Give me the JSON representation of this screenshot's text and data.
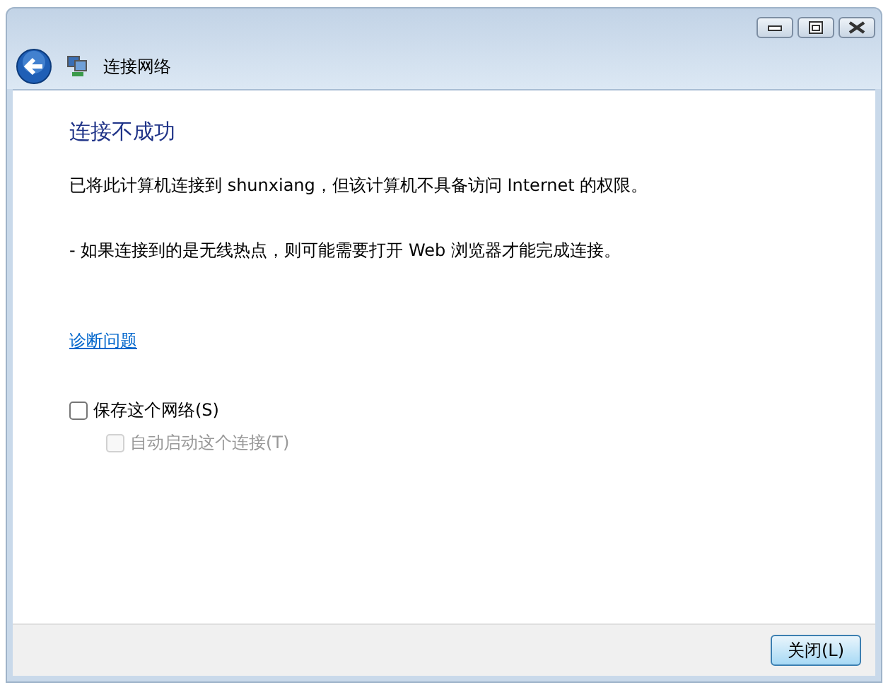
{
  "window": {
    "title": "连接网络"
  },
  "heading": "连接不成功",
  "message": "已将此计算机连接到 shunxiang，但该计算机不具备访问 Internet 的权限。",
  "hint": "- 如果连接到的是无线热点，则可能需要打开 Web 浏览器才能完成连接。",
  "link": "诊断问题",
  "options": [
    {
      "label": "保存这个网络(S)",
      "checked": false,
      "disabled": false,
      "children": [
        {
          "label": "自动启动这个连接(T)",
          "checked": false,
          "disabled": true
        }
      ]
    }
  ],
  "buttons": [
    "关闭(L)"
  ]
}
